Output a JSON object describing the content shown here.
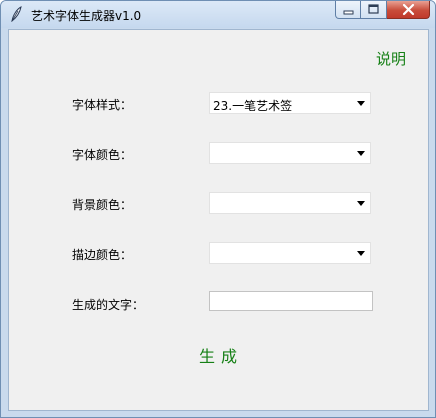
{
  "window": {
    "title": "艺术字体生成器v1.0"
  },
  "help": {
    "label": "说明"
  },
  "form": {
    "rows": [
      {
        "label": "字体样式：",
        "value": "23.一笔艺术签"
      },
      {
        "label": "字体颜色：",
        "value": ""
      },
      {
        "label": "背景颜色：",
        "value": ""
      },
      {
        "label": "描边颜色：",
        "value": ""
      }
    ],
    "text_label": "生成的文字：",
    "text_value": ""
  },
  "generate": {
    "label": "生成"
  },
  "colors": {
    "accent_text": "#168016",
    "client_bg": "#f0f0f0",
    "title_bar": "#c9daed"
  },
  "icons": [
    "feather-icon",
    "minimize-icon",
    "maximize-icon",
    "close-icon",
    "chevron-down-icon"
  ]
}
